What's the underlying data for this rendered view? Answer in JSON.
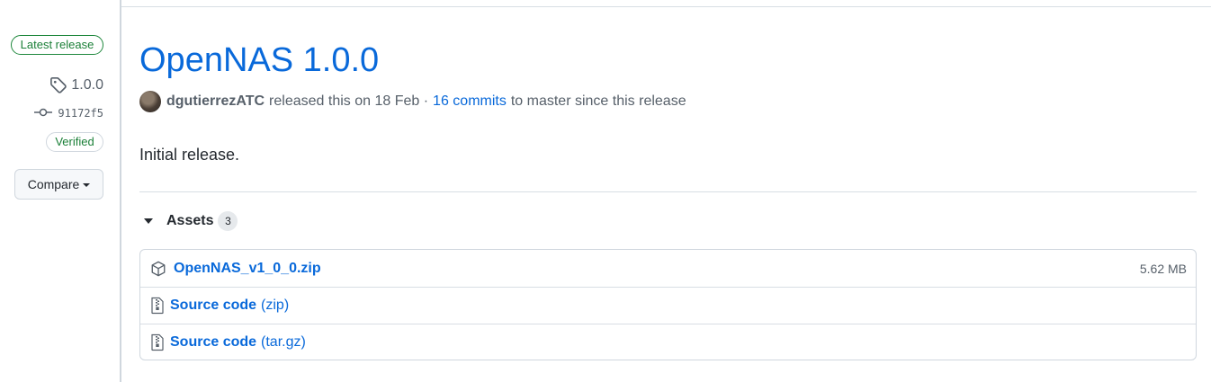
{
  "sidebar": {
    "latest_badge": "Latest release",
    "tag": "1.0.0",
    "commit": "91172f5",
    "verified_badge": "Verified",
    "compare_label": "Compare"
  },
  "release": {
    "title": "OpenNAS 1.0.0",
    "author": "dgutierrezATC",
    "released_text": "released this on 18 Feb ·",
    "commits_link": "16 commits",
    "commits_suffix": "to master since this release",
    "body": "Initial release."
  },
  "assets": {
    "label": "Assets",
    "count": "3",
    "items": [
      {
        "name": "OpenNAS_v1_0_0.zip",
        "suffix": "",
        "size": "5.62 MB",
        "icon": "package-icon"
      },
      {
        "name": "Source code",
        "suffix": "(zip)",
        "size": "",
        "icon": "file-zip-icon"
      },
      {
        "name": "Source code",
        "suffix": "(tar.gz)",
        "size": "",
        "icon": "file-zip-icon"
      }
    ]
  },
  "colors": {
    "link": "#0969da",
    "success": "#1a7f37",
    "muted": "#57606a",
    "border": "#d0d7de"
  }
}
